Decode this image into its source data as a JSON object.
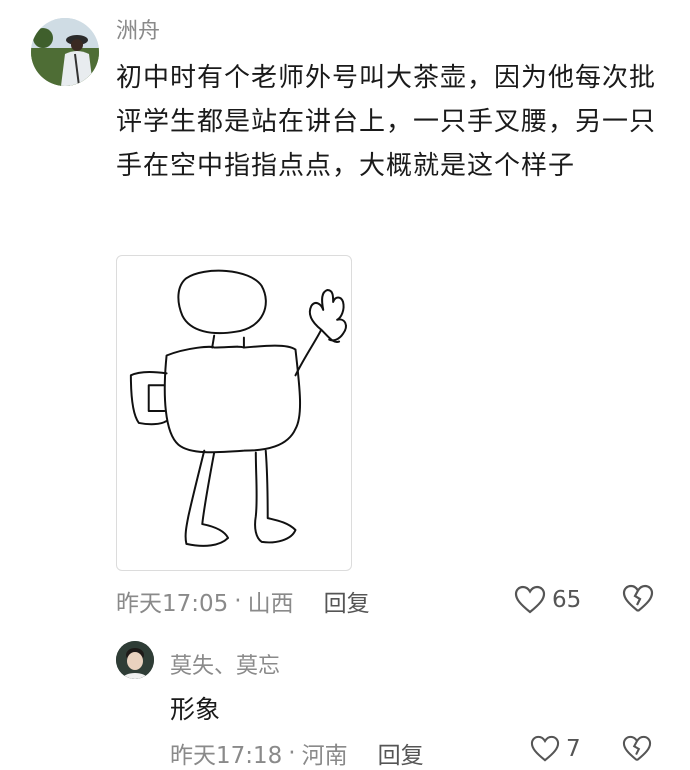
{
  "comment": {
    "username": "洲舟",
    "text": "初中时有个老师外号叫大茶壶，因为他每次批评学生都是站在讲台上，一只手叉腰，另一只手在空中指指点点，大概就是这个样子",
    "time": "昨天17:05",
    "separator": "·",
    "location": "山西",
    "reply_label": "回复",
    "like_count": "65",
    "attached_image": "teapot-teacher-doodle"
  },
  "reply": {
    "username": "莫失、莫忘",
    "text": "形象",
    "time": "昨天17:18",
    "separator": "·",
    "location": "河南",
    "reply_label": "回复",
    "like_count": "7"
  },
  "colors": {
    "text": "#1a1a1a",
    "muted": "#8a8a8a",
    "border": "#dcdcdc",
    "background": "#ffffff"
  },
  "icons": [
    "heart-outline-icon",
    "broken-heart-icon"
  ]
}
